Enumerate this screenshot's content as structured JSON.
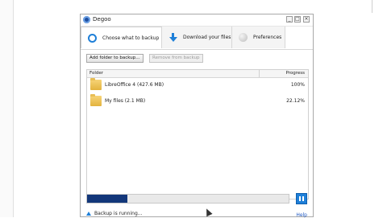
{
  "window": {
    "title": "Degoo"
  },
  "tabs": [
    {
      "label": "Choose what to backup",
      "icon": "ring-icon",
      "active": true
    },
    {
      "label": "Download your files",
      "icon": "download-arrow-icon",
      "active": false
    },
    {
      "label": "Preferences",
      "icon": "preferences-ball-icon",
      "active": false
    }
  ],
  "toolbar": {
    "add_label": "Add folder to backup...",
    "remove_label": "Remove from backup"
  },
  "list": {
    "columns": {
      "folder": "Folder",
      "progress": "Progress"
    },
    "rows": [
      {
        "name": "LibreOffice 4  (427.6 MB)",
        "progress": "100%"
      },
      {
        "name": "My files  (2.1 MB)",
        "progress": "22.12%"
      }
    ]
  },
  "backup": {
    "progress_fraction": 0.2,
    "status": "Backup is running..."
  },
  "footer": {
    "help": "Help"
  },
  "colors": {
    "accent": "#1e7fd8",
    "progress_fill": "#13377a"
  }
}
